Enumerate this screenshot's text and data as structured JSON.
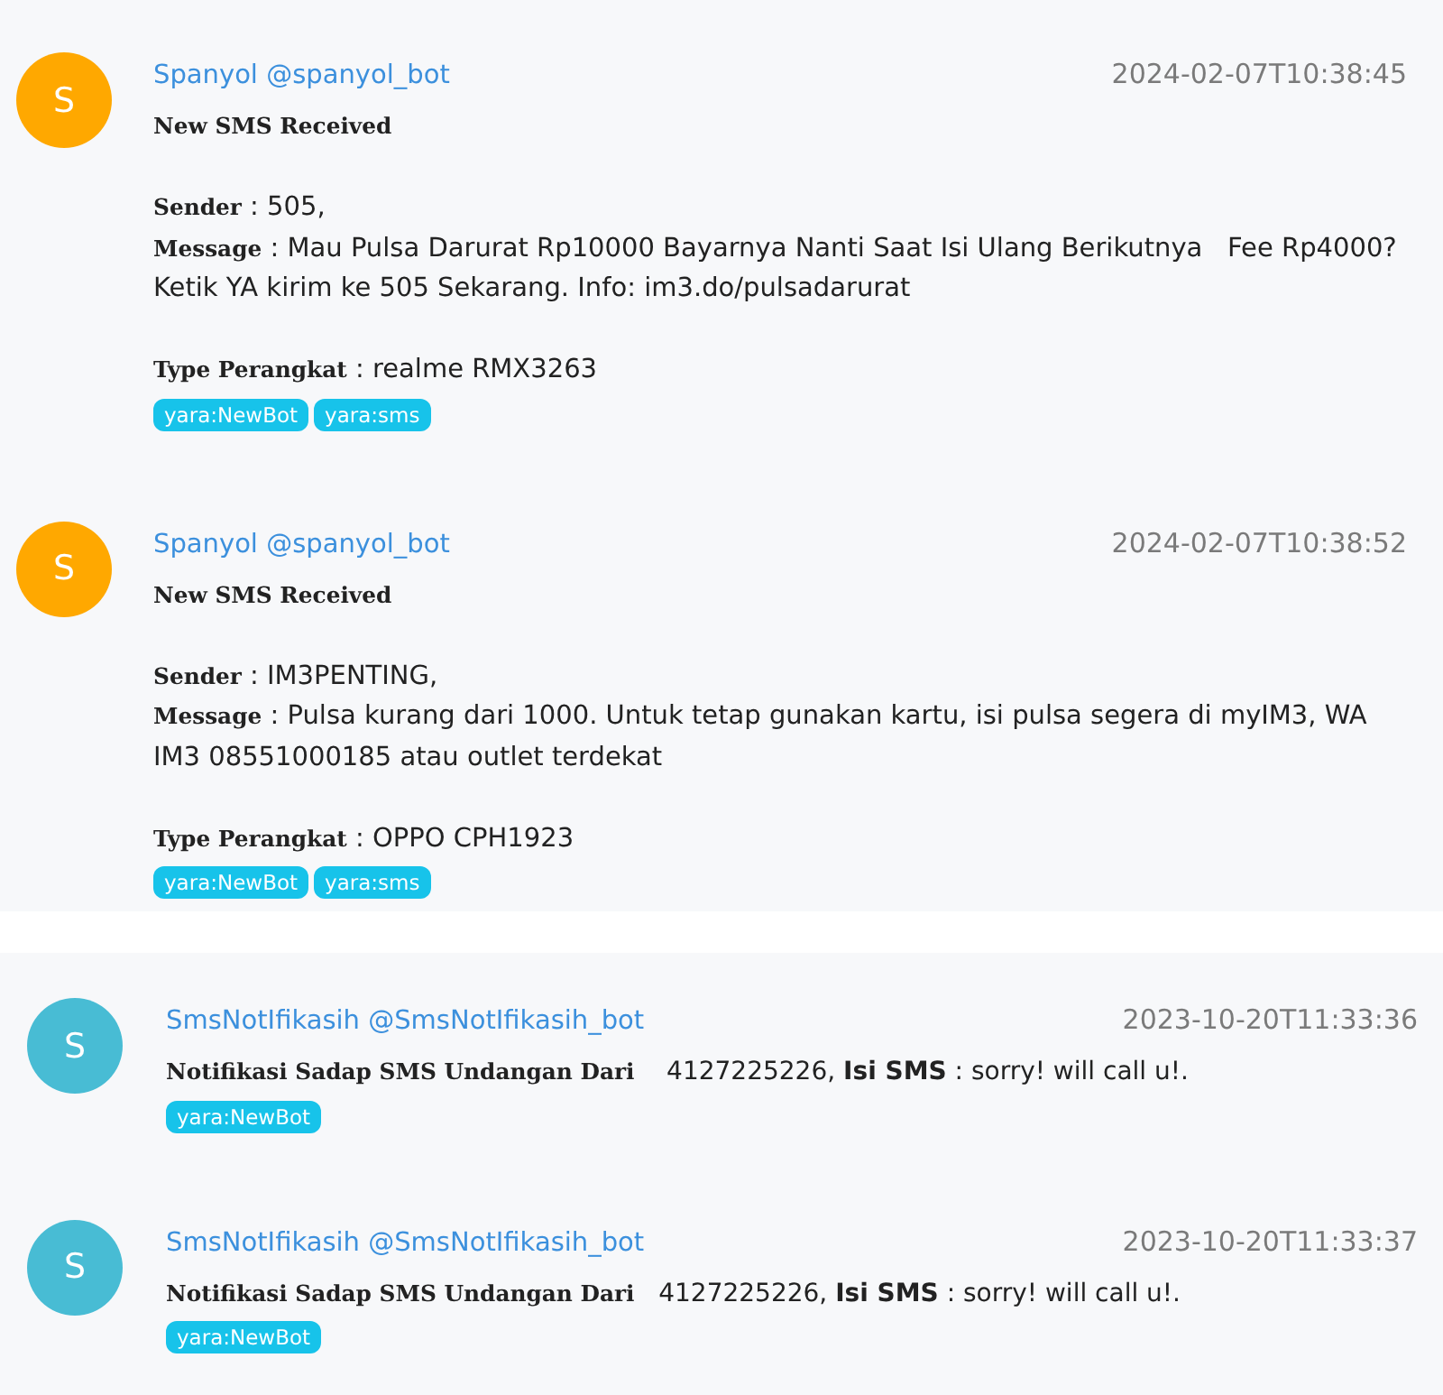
{
  "sections": [
    {
      "messages": [
        {
          "avatar": {
            "letter": "S",
            "color": "#ffa800"
          },
          "sender": "Spanyol @spanyol_bot",
          "time": "2024-02-07T10:38:45",
          "paragraphs": [
            {
              "lines": [
                {
                  "label": "New SMS Received"
                }
              ]
            },
            {
              "lines": [
                {
                  "label": "Sender",
                  "text": " : 505,"
                },
                {
                  "label": "Message",
                  "text": " : Mau Pulsa Darurat Rp10000 Bayarnya Nanti Saat Isi Ulang Berikutnya   Fee Rp4000? Ketik YA kirim ke 505 Sekarang. Info: im3.do/pulsadarurat"
                }
              ]
            },
            {
              "lines": [
                {
                  "label": "Type Perangkat",
                  "text": " : realme RMX3263"
                }
              ]
            }
          ],
          "tags": [
            "yara:NewBot",
            "yara:sms"
          ]
        },
        {
          "avatar": {
            "letter": "S",
            "color": "#ffa800"
          },
          "sender": "Spanyol @spanyol_bot",
          "time": "2024-02-07T10:38:52",
          "paragraphs": [
            {
              "lines": [
                {
                  "label": "New SMS Received"
                }
              ]
            },
            {
              "lines": [
                {
                  "label": "Sender",
                  "text": " : IM3PENTING,"
                },
                {
                  "label": "Message",
                  "text": " : Pulsa kurang dari 1000. Untuk tetap gunakan kartu, isi pulsa segera di myIM3, WA IM3 08551000185 atau outlet terdekat"
                }
              ]
            },
            {
              "lines": [
                {
                  "label": "Type Perangkat",
                  "text": " : OPPO CPH1923"
                }
              ]
            }
          ],
          "tags": [
            "yara:NewBot",
            "yara:sms"
          ]
        }
      ]
    },
    {
      "messages": [
        {
          "avatar": {
            "letter": "S",
            "color": "#48bcd4"
          },
          "sender": "SmsNotIfikasih @SmsNotIfikasih_bot",
          "time": "2023-10-20T11:33:36",
          "paragraphs": [
            {
              "lines": [
                {
                  "label": "Notifikasi Sadap SMS Undangan Dari",
                  "text": "    4127225226, **Isi SMS** : sorry! will call u!."
                }
              ]
            }
          ],
          "tags": [
            "yara:NewBot"
          ]
        },
        {
          "avatar": {
            "letter": "S",
            "color": "#48bcd4"
          },
          "sender": "SmsNotIfikasih @SmsNotIfikasih_bot",
          "time": "2023-10-20T11:33:37",
          "paragraphs": [
            {
              "lines": [
                {
                  "label": "Notifikasi Sadap SMS Undangan Dari",
                  "text": "   4127225226, **Isi SMS** : sorry! will call u!."
                }
              ]
            }
          ],
          "tags": [
            "yara:NewBot"
          ]
        }
      ]
    }
  ]
}
